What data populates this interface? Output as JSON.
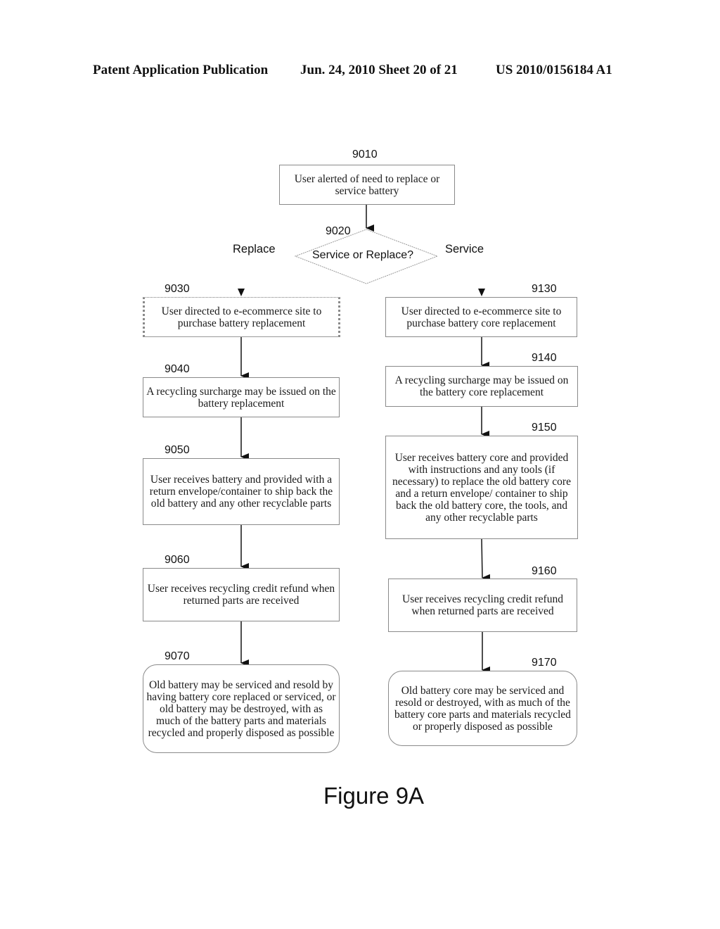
{
  "header": {
    "publication": "Patent Application Publication",
    "date_sheet": "Jun. 24, 2010  Sheet 20 of 21",
    "patent_number": "US 2010/0156184 A1"
  },
  "diagram": {
    "start": {
      "id": "9010",
      "text": "User alerted of need to replace or service battery"
    },
    "decision": {
      "id": "9020",
      "text": "Service or Replace?",
      "left_branch": "Replace",
      "right_branch": "Service"
    },
    "replace_path": [
      {
        "id": "9030",
        "text": "User directed to e-ecommerce site to purchase battery replacement"
      },
      {
        "id": "9040",
        "text": "A recycling surcharge may be issued on the battery replacement"
      },
      {
        "id": "9050",
        "text": "User receives battery and provided with a return envelope/container to ship back the old battery and any other recyclable parts"
      },
      {
        "id": "9060",
        "text": "User receives recycling credit refund when returned parts are received"
      },
      {
        "id": "9070",
        "text": "Old battery may be serviced and resold by having battery core replaced or serviced, or old battery may be destroyed, with as much of the battery parts and materials recycled and properly disposed as possible"
      }
    ],
    "service_path": [
      {
        "id": "9130",
        "text": "User directed to e-ecommerce site to purchase battery core replacement"
      },
      {
        "id": "9140",
        "text": "A recycling surcharge may be issued on the battery core replacement"
      },
      {
        "id": "9150",
        "text": "User receives battery core and provided with instructions and any tools (if necessary) to replace the old battery core and a return envelope/ container to ship back the old battery core, the tools, and any other recyclable parts"
      },
      {
        "id": "9160",
        "text": "User receives recycling credit refund when returned parts are received"
      },
      {
        "id": "9170",
        "text": "Old battery core may be serviced and resold or destroyed, with as much of the battery core parts and materials recycled or properly disposed as possible"
      }
    ]
  },
  "caption": "Figure 9A"
}
